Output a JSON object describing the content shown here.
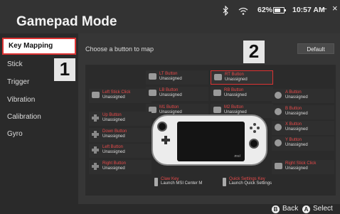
{
  "app": {
    "title": "Gamepad Mode"
  },
  "status": {
    "battery": "62%",
    "time": "10:57 AM",
    "minimize": "–",
    "close": "×",
    "icons": [
      "bluetooth-icon",
      "wifi-icon",
      "battery-icon"
    ]
  },
  "sidebar": {
    "items": [
      {
        "label": "Key Mapping",
        "active": true
      },
      {
        "label": "Stick"
      },
      {
        "label": "Trigger"
      },
      {
        "label": "Vibration"
      },
      {
        "label": "Calibration"
      },
      {
        "label": "Gyro"
      }
    ]
  },
  "main": {
    "subtitle": "Choose a button to map",
    "default_label": "Default"
  },
  "buttons": {
    "lt": {
      "name": "LT Button",
      "state": "Unassigned"
    },
    "rt": {
      "name": "RT Button",
      "state": "Unassigned"
    },
    "lb": {
      "name": "LB Button",
      "state": "Unassigned"
    },
    "rb": {
      "name": "RB Button",
      "state": "Unassigned"
    },
    "left_stick_click": {
      "name": "Left Stick Click",
      "state": "Unassigned"
    },
    "m1": {
      "name": "M1 Button",
      "state": "Unassigned"
    },
    "m2": {
      "name": "M2 Button",
      "state": "Unassigned"
    },
    "a": {
      "name": "A Button",
      "state": "Unassigned"
    },
    "b": {
      "name": "B Button",
      "state": "Unassigned"
    },
    "x": {
      "name": "X Button",
      "state": "Unassigned"
    },
    "y": {
      "name": "Y Button",
      "state": "Unassigned"
    },
    "up": {
      "name": "Up Button",
      "state": "Unassigned"
    },
    "down": {
      "name": "Down Button",
      "state": "Unassigned"
    },
    "left": {
      "name": "Left Button",
      "state": "Unassigned"
    },
    "right": {
      "name": "Right Button",
      "state": "Unassigned"
    },
    "right_stick_click": {
      "name": "Right Stick Click",
      "state": "Unassigned"
    },
    "claw": {
      "name": "Claw Key",
      "state": "Launch MSI Center M"
    },
    "quick_settings": {
      "name": "Quick Settings Key",
      "state": "Launch Quick Settings"
    }
  },
  "device": {
    "logo": "msi"
  },
  "markers": {
    "one": "1",
    "two": "2"
  },
  "footer": {
    "back_glyph": "B",
    "back_label": "Back",
    "select_glyph": "A",
    "select_label": "Select"
  },
  "colors": {
    "accent": "#d33333",
    "label_red": "#e84a4a"
  }
}
